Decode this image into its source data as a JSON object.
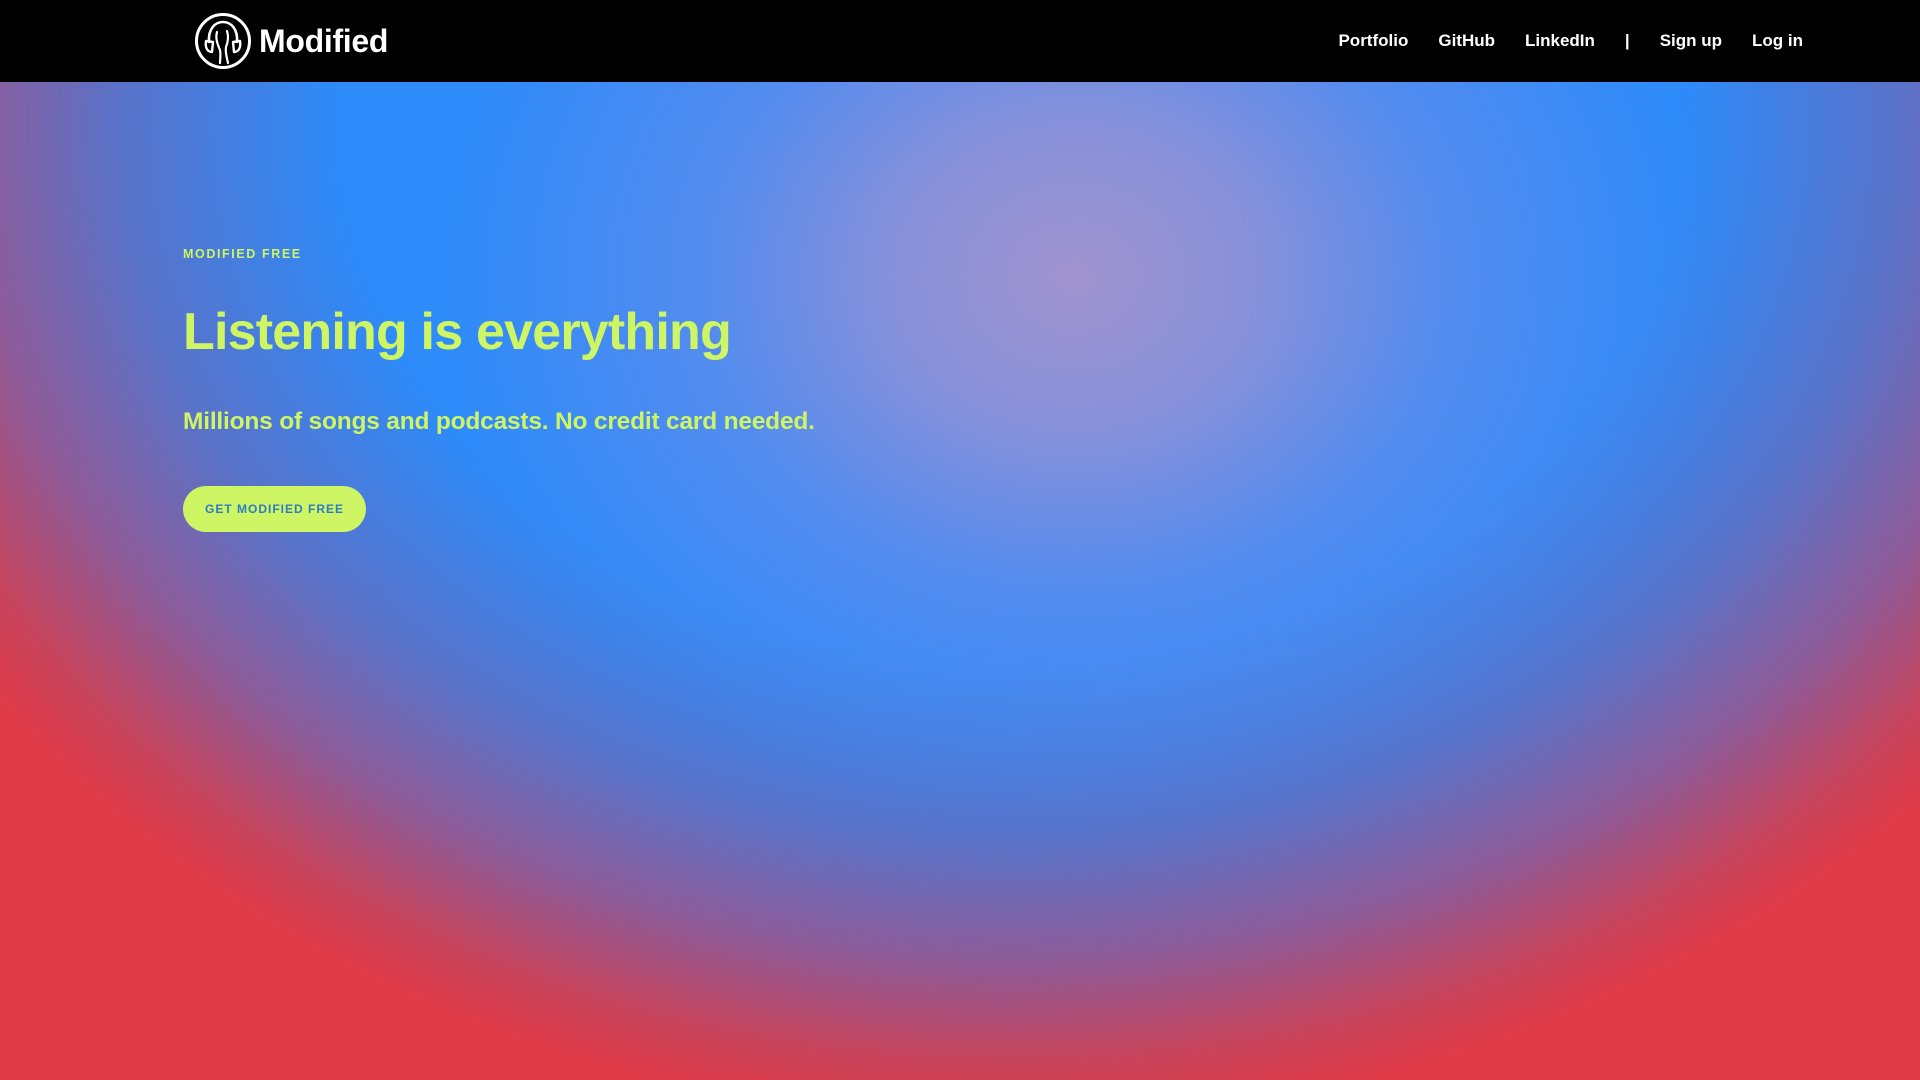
{
  "navbar": {
    "brand": {
      "name": "Modified",
      "logo_icon": "headphones-head-logo-icon"
    },
    "links": [
      {
        "label": "Portfolio"
      },
      {
        "label": "GitHub"
      },
      {
        "label": "LinkedIn"
      }
    ],
    "separator": "|",
    "auth": {
      "signup_label": "Sign up",
      "login_label": "Log in"
    }
  },
  "hero": {
    "eyebrow": "MODIFIED FREE",
    "headline": "Listening is everything",
    "subheadline": "Millions of songs and podcasts. No credit card needed.",
    "cta_label": "GET MODIFIED FREE"
  },
  "colors": {
    "navbar_bg": "#000000",
    "accent_lime": "#cdf564",
    "hero_blue": "#2d8bfa",
    "hero_lavender": "#a594ce",
    "hero_red": "#e13b48",
    "cta_text": "#2d7cc4"
  }
}
